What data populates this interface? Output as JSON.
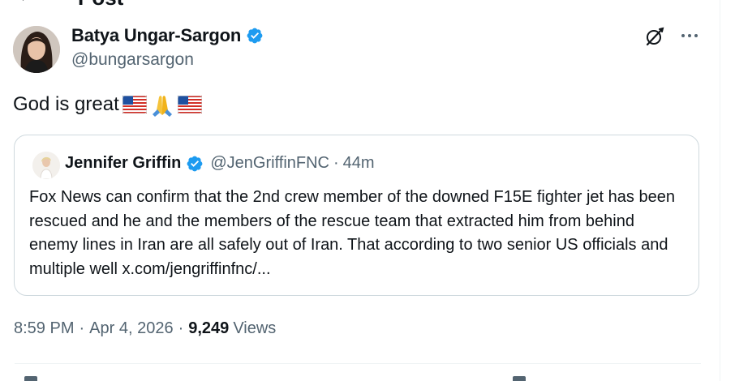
{
  "header": {
    "title": "Post",
    "back_icon": "arrow-left-icon"
  },
  "author": {
    "name": "Batya Ungar-Sargon",
    "handle": "@bungarsargon",
    "verified": true,
    "badge_color": "#1d9bf0"
  },
  "tweet": {
    "text": "God is great",
    "emojis": [
      "us-flag",
      "folded-hands",
      "us-flag"
    ]
  },
  "quote": {
    "name": "Jennifer Griffin",
    "handle": "@JenGriffinFNC",
    "dot": "·",
    "time": "44m",
    "verified": true,
    "body": "Fox News can confirm that the 2nd crew member of the downed F15E fighter jet has been rescued and he and the members of the rescue team that extracted him from behind enemy lines in Iran are all safely out of Iran. That according to two senior US officials and multiple well x.com/jengriffinfnc/..."
  },
  "meta": {
    "time": "8:59 PM",
    "date": "Apr 4, 2026",
    "sep": "·",
    "views_count": "9,249",
    "views_label": "Views"
  },
  "icons": {
    "grok": "grok-icon",
    "more": "more-icon"
  },
  "colors": {
    "text": "#0f1419",
    "secondary": "#536471",
    "border": "#cfd9de",
    "verified": "#1d9bf0"
  }
}
